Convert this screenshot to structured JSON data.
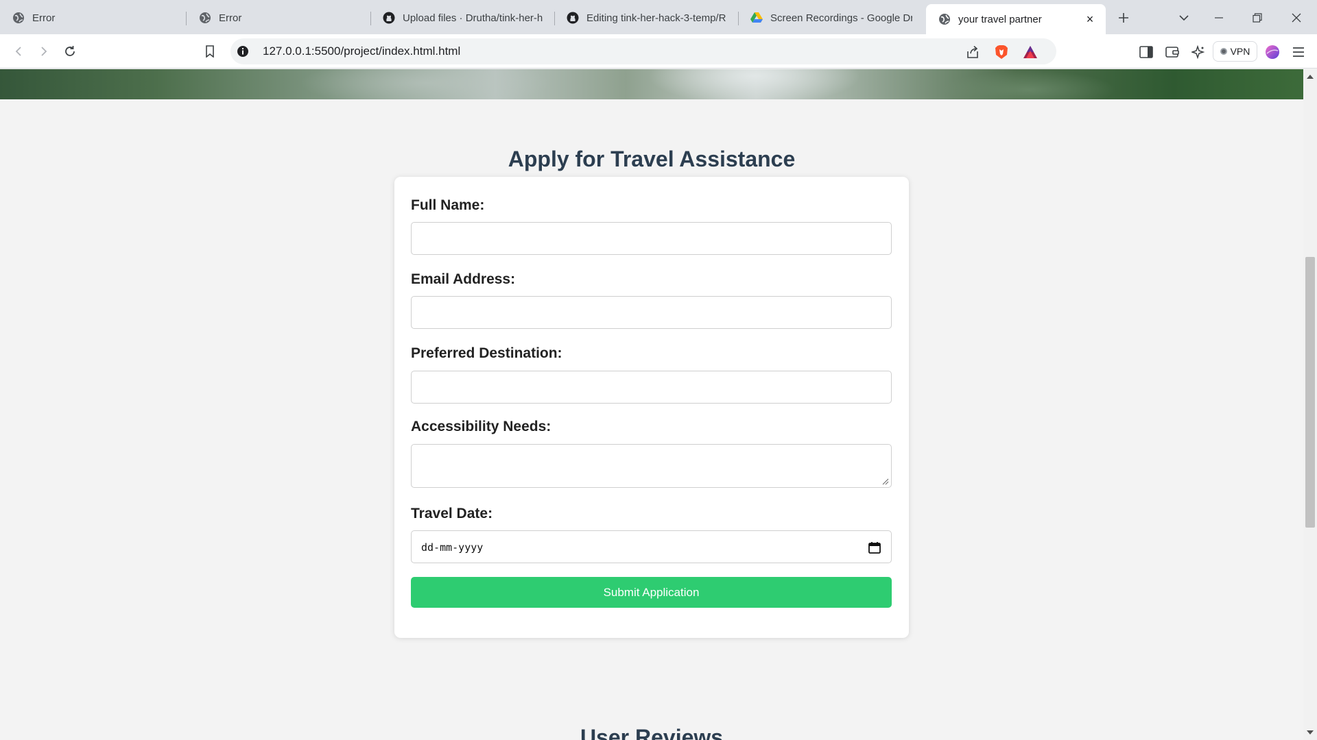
{
  "browser": {
    "tabs": [
      {
        "title": "Error",
        "icon": "globe-icon"
      },
      {
        "title": "Error",
        "icon": "globe-icon"
      },
      {
        "title": "Upload files · Drutha/tink-her-h",
        "icon": "github-icon"
      },
      {
        "title": "Editing tink-her-hack-3-temp/R",
        "icon": "github-icon"
      },
      {
        "title": "Screen Recordings - Google Dr",
        "icon": "google-drive-icon"
      },
      {
        "title": "your travel partner",
        "icon": "globe-icon",
        "active": true
      }
    ],
    "url": "127.0.0.1:5500/project/index.html.html",
    "vpn_label": "VPN"
  },
  "page": {
    "form_title": "Apply for Travel Assistance",
    "fields": {
      "full_name": {
        "label": "Full Name:",
        "value": ""
      },
      "email": {
        "label": "Email Address:",
        "value": ""
      },
      "destination": {
        "label": "Preferred Destination:",
        "value": ""
      },
      "accessibility": {
        "label": "Accessibility Needs:",
        "value": ""
      },
      "travel_date": {
        "label": "Travel Date:",
        "placeholder": "dd-mm-yyyy"
      }
    },
    "submit_label": "Submit Application",
    "reviews_title": "User Reviews"
  },
  "colors": {
    "accent_green": "#2ecc71",
    "heading": "#2c3e50"
  }
}
